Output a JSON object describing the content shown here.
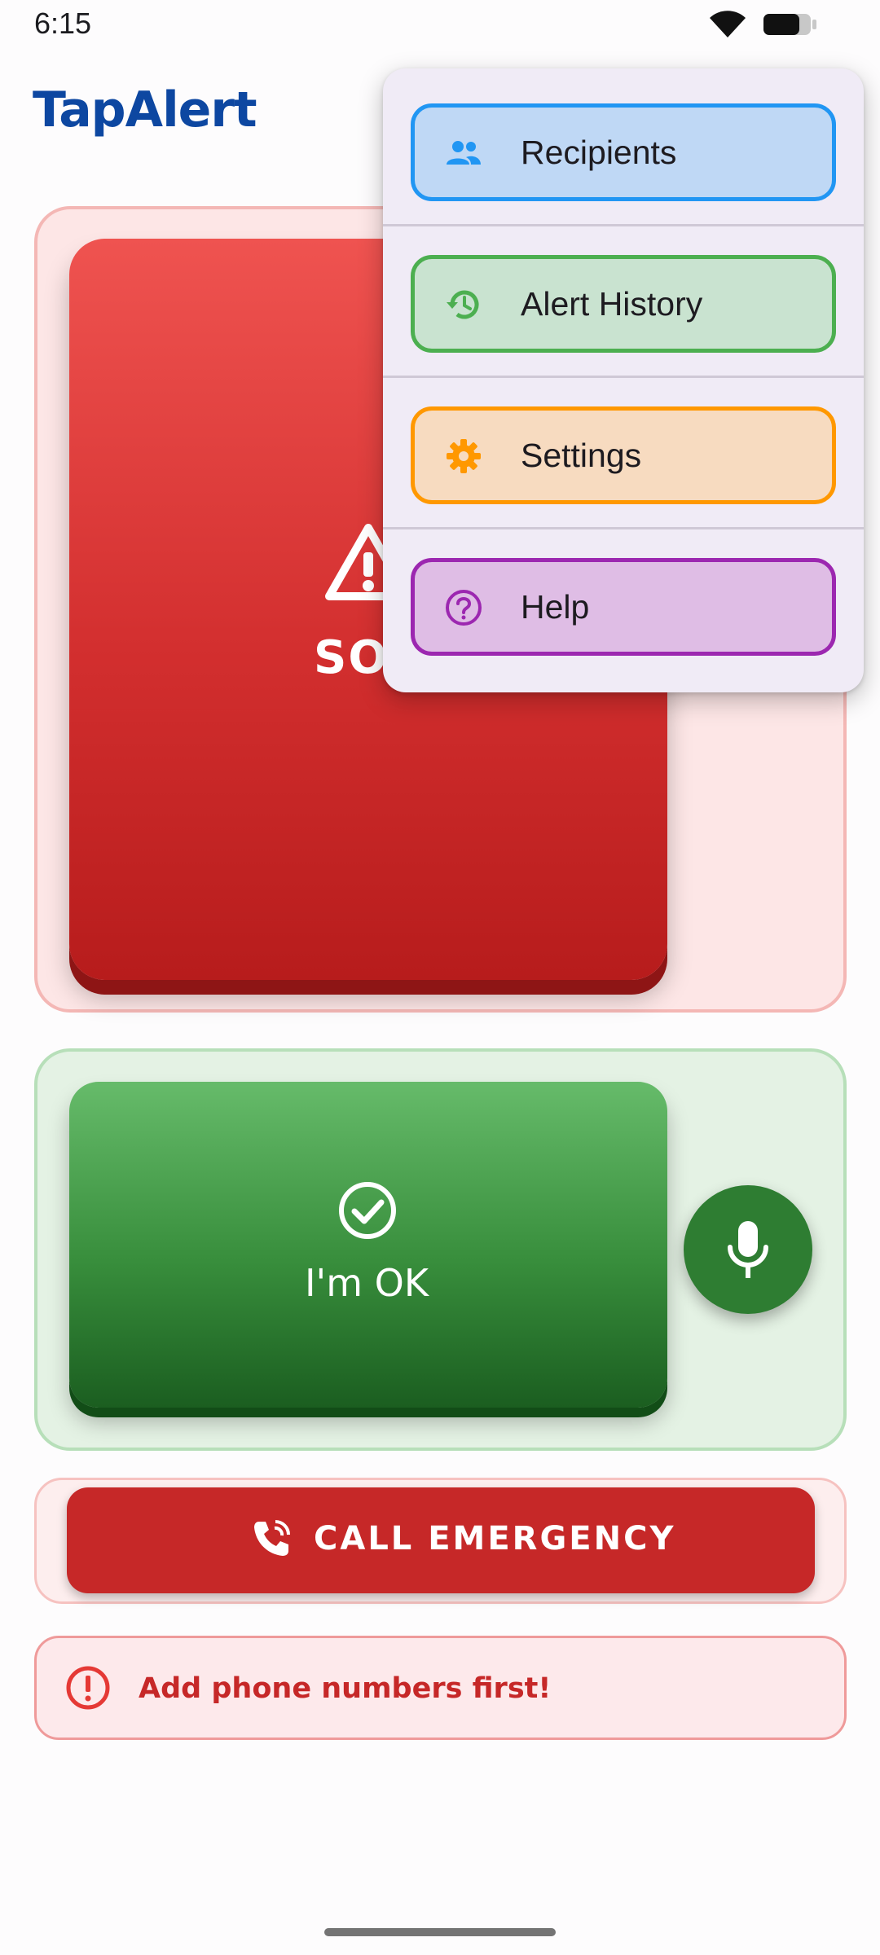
{
  "status_bar": {
    "time": "6:15"
  },
  "app": {
    "title": "TapAlert"
  },
  "sos": {
    "label": "SOS",
    "icon": "warning-triangle-icon"
  },
  "ok": {
    "label": "I'm OK",
    "icon": "check-circle-icon"
  },
  "mic": {
    "icon": "microphone-icon"
  },
  "emergency": {
    "label": "CALL EMERGENCY",
    "icon": "phone-call-icon"
  },
  "warning": {
    "text": "Add phone numbers first!",
    "icon": "error-circle-icon"
  },
  "menu": {
    "items": [
      {
        "label": "Recipients",
        "icon": "people-icon",
        "color": "#2196f3"
      },
      {
        "label": "Alert History",
        "icon": "history-icon",
        "color": "#4caf50"
      },
      {
        "label": "Settings",
        "icon": "gear-icon",
        "color": "#ff9800"
      },
      {
        "label": "Help",
        "icon": "help-circle-icon",
        "color": "#9c27b0"
      }
    ]
  },
  "colors": {
    "brand": "#0d47a1",
    "sos": "#d32f2f",
    "ok": "#388e3c",
    "emergency": "#c62828"
  }
}
